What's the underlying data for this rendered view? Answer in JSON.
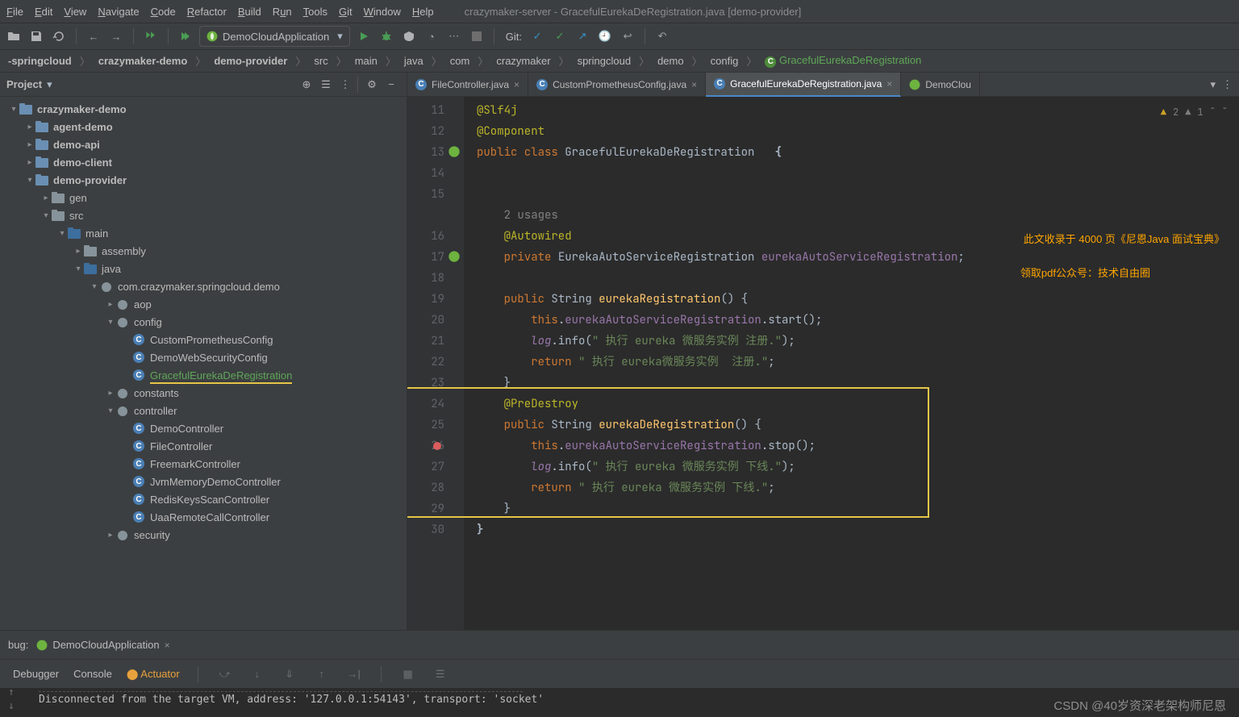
{
  "menubar": {
    "items": [
      "File",
      "Edit",
      "View",
      "Navigate",
      "Code",
      "Refactor",
      "Build",
      "Run",
      "Tools",
      "Git",
      "Window",
      "Help"
    ],
    "window_title": "crazymaker-server - GracefulEurekaDeRegistration.java [demo-provider]"
  },
  "toolbar": {
    "run_config": "DemoCloudApplication",
    "git_label": "Git:"
  },
  "breadcrumbs": [
    "-springcloud",
    "crazymaker-demo",
    "demo-provider",
    "src",
    "main",
    "java",
    "com",
    "crazymaker",
    "springcloud",
    "demo",
    "config",
    "GracefulEurekaDeRegistration"
  ],
  "project": {
    "title": "Project",
    "tree": [
      {
        "d": 0,
        "arrow": "▾",
        "icon": "module",
        "label": "crazymaker-demo",
        "bold": true
      },
      {
        "d": 1,
        "arrow": "▸",
        "icon": "module",
        "label": "agent-demo",
        "bold": true
      },
      {
        "d": 1,
        "arrow": "▸",
        "icon": "module",
        "label": "demo-api",
        "bold": true
      },
      {
        "d": 1,
        "arrow": "▸",
        "icon": "module",
        "label": "demo-client",
        "bold": true
      },
      {
        "d": 1,
        "arrow": "▾",
        "icon": "module",
        "label": "demo-provider",
        "bold": true
      },
      {
        "d": 2,
        "arrow": "▸",
        "icon": "folder",
        "label": "gen"
      },
      {
        "d": 2,
        "arrow": "▾",
        "icon": "folder",
        "label": "src"
      },
      {
        "d": 3,
        "arrow": "▾",
        "icon": "src-folder",
        "label": "main"
      },
      {
        "d": 4,
        "arrow": "▸",
        "icon": "folder",
        "label": "assembly"
      },
      {
        "d": 4,
        "arrow": "▾",
        "icon": "src-folder",
        "label": "java"
      },
      {
        "d": 5,
        "arrow": "▾",
        "icon": "package",
        "label": "com.crazymaker.springcloud.demo"
      },
      {
        "d": 6,
        "arrow": "▸",
        "icon": "package",
        "label": "aop"
      },
      {
        "d": 6,
        "arrow": "▾",
        "icon": "package",
        "label": "config"
      },
      {
        "d": 7,
        "arrow": " ",
        "icon": "class",
        "label": "CustomPrometheusConfig"
      },
      {
        "d": 7,
        "arrow": " ",
        "icon": "class",
        "label": "DemoWebSecurityConfig"
      },
      {
        "d": 7,
        "arrow": " ",
        "icon": "class",
        "label": "GracefulEurekaDeRegistration",
        "selected": true,
        "underline": true
      },
      {
        "d": 6,
        "arrow": "▸",
        "icon": "package",
        "label": "constants"
      },
      {
        "d": 6,
        "arrow": "▾",
        "icon": "package",
        "label": "controller"
      },
      {
        "d": 7,
        "arrow": " ",
        "icon": "class",
        "label": "DemoController"
      },
      {
        "d": 7,
        "arrow": " ",
        "icon": "class",
        "label": "FileController"
      },
      {
        "d": 7,
        "arrow": " ",
        "icon": "class",
        "label": "FreemarkController"
      },
      {
        "d": 7,
        "arrow": " ",
        "icon": "class",
        "label": "JvmMemoryDemoController"
      },
      {
        "d": 7,
        "arrow": " ",
        "icon": "class",
        "label": "RedisKeysScanController"
      },
      {
        "d": 7,
        "arrow": " ",
        "icon": "class",
        "label": "UaaRemoteCallController"
      },
      {
        "d": 6,
        "arrow": "▸",
        "icon": "package",
        "label": "security"
      }
    ]
  },
  "editor": {
    "tabs": [
      {
        "label": "FileController.java",
        "icon": "class",
        "active": false
      },
      {
        "label": "CustomPrometheusConfig.java",
        "icon": "class",
        "active": false
      },
      {
        "label": "GracefulEurekaDeRegistration.java",
        "icon": "class",
        "active": true
      },
      {
        "label": "DemoClou",
        "icon": "spring",
        "active": false,
        "overflow": true
      }
    ],
    "warnings": {
      "yellow": "2",
      "gray": "1"
    },
    "lines": [
      {
        "n": 11,
        "html": "<span class='c-ann'>@Slf4j</span>"
      },
      {
        "n": 12,
        "html": "<span class='c-ann'>@Component</span>"
      },
      {
        "n": 13,
        "html": "<span class='c-key'>public class </span><span>GracefulEurekaDeRegistration </span>  <span class='c-bold'>{</span>",
        "gut": "spring"
      },
      {
        "n": 14,
        "html": ""
      },
      {
        "n": 15,
        "html": ""
      },
      {
        "n": "",
        "html": "    <span class='c-comment'>2 usages</span>"
      },
      {
        "n": 16,
        "html": "    <span class='c-ann'>@Autowired</span>"
      },
      {
        "n": 17,
        "html": "    <span class='c-key'>private </span><span>EurekaAutoServiceRegistration </span><span class='c-field'>eurekaAutoServiceRegistration</span>;",
        "gut": "spring"
      },
      {
        "n": 18,
        "html": ""
      },
      {
        "n": 19,
        "html": "    <span class='c-key'>public </span><span>String </span><span class='c-method'>eurekaRegistration</span>() {"
      },
      {
        "n": 20,
        "html": "        <span class='c-key'>this</span>.<span class='c-field'>eurekaAutoServiceRegistration</span>.start();"
      },
      {
        "n": 21,
        "html": "        <span class='c-ital'>log</span>.info(<span class='c-str'>\" 执行 eureka 微服务实例 注册.\"</span>);"
      },
      {
        "n": 22,
        "html": "        <span class='c-key'>return </span><span class='c-str'>\" 执行 eureka微服务实例  注册.\"</span>;"
      },
      {
        "n": 23,
        "html": "    }"
      },
      {
        "n": 24,
        "html": "    <span class='c-ann'>@PreDestroy</span>"
      },
      {
        "n": 25,
        "html": "    <span class='c-key'>public </span><span>String </span><span class='c-method'>eurekaDeRegistration</span>() {"
      },
      {
        "n": 26,
        "html": "        <span class='c-key'>this</span>.<span class='c-field'>eurekaAutoServiceRegistration</span>.stop();",
        "bp": true,
        "caret": true
      },
      {
        "n": 27,
        "html": "        <span class='c-ital'>log</span>.info(<span class='c-str'>\" 执行 eureka 微服务实例 下线.\"</span>);"
      },
      {
        "n": 28,
        "html": "        <span class='c-key'>return </span><span class='c-str'>\" 执行 eureka 微服务实例 下线.\"</span>;"
      },
      {
        "n": 29,
        "html": "    }"
      },
      {
        "n": 30,
        "html": "<span class='c-bold'>}</span>"
      }
    ],
    "annotation_1": "此文收录于 4000 页《尼恩Java 面试宝典》",
    "annotation_2": "领取pdf公众号：技术自由圈"
  },
  "debug": {
    "label": "bug:",
    "run_tab": "DemoCloudApplication",
    "tabs": [
      "Debugger",
      "Console",
      "Actuator"
    ],
    "console_text": "Disconnected from the target VM, address: '127.0.0.1:54143', transport: 'socket'",
    "watermark": "CSDN @40岁资深老架构师尼恩"
  }
}
